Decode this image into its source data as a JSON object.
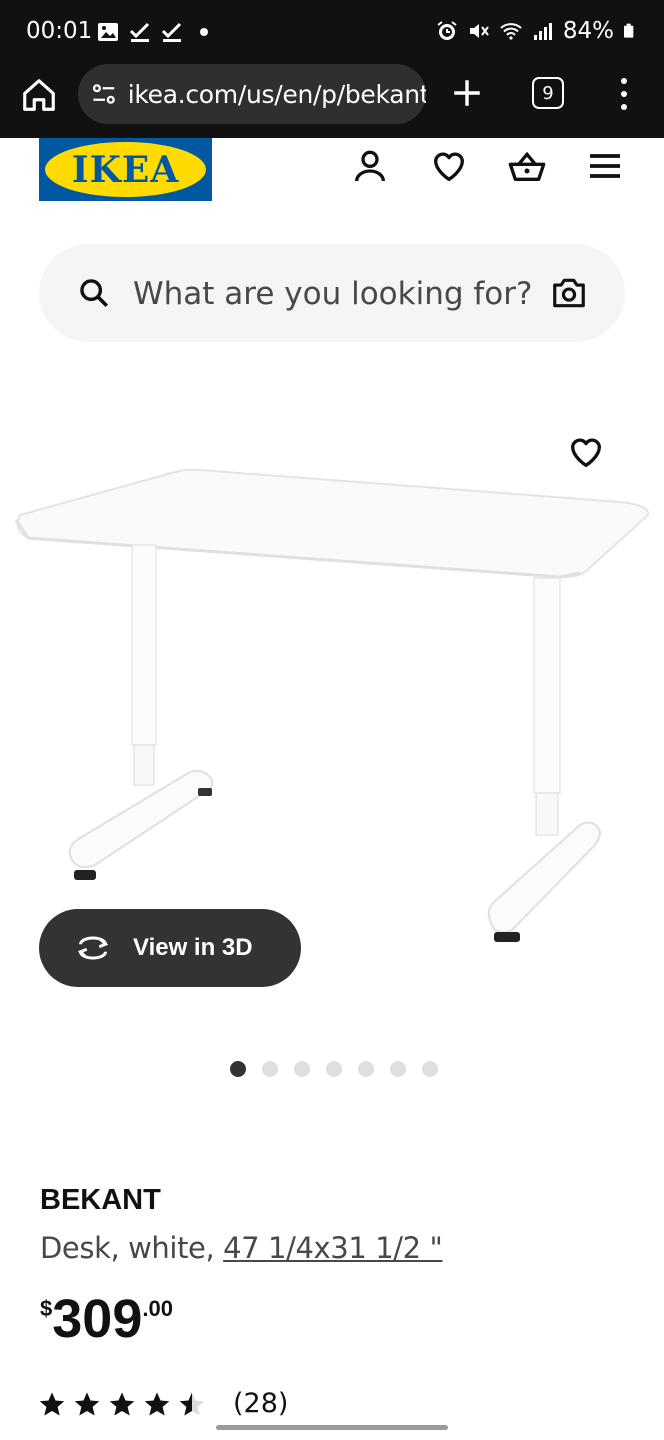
{
  "status_bar": {
    "time": "00:01",
    "battery": "84%",
    "left_icons": [
      "gallery-icon",
      "check-icon",
      "check-icon",
      "dot-icon"
    ],
    "right_icons": [
      "alarm-icon",
      "mute-icon",
      "wifi-icon",
      "signal-icon",
      "battery-icon"
    ]
  },
  "browser": {
    "url": "ikea.com/us/en/p/bekant",
    "tab_count": "9"
  },
  "header": {
    "logo_text": "IKEA",
    "icons": [
      "account-icon",
      "heart-icon",
      "basket-icon",
      "menu-icon"
    ]
  },
  "search": {
    "placeholder": "What are you looking for?"
  },
  "gallery": {
    "view_3d_label": "View in 3D",
    "dot_count": 7,
    "active_dot": 1
  },
  "product": {
    "name": "BEKANT",
    "desc_prefix": "Desk, white, ",
    "measurement": "47 1/4x31 1/2 \"",
    "price_currency": "$",
    "price_integer": "309",
    "price_decimal": ".00",
    "rating": 4.5,
    "rating_max": 5,
    "review_count": "(28)"
  },
  "colors": {
    "ikea_blue": "#0058a3",
    "ikea_yellow": "#ffdb00",
    "dark": "#111111"
  }
}
